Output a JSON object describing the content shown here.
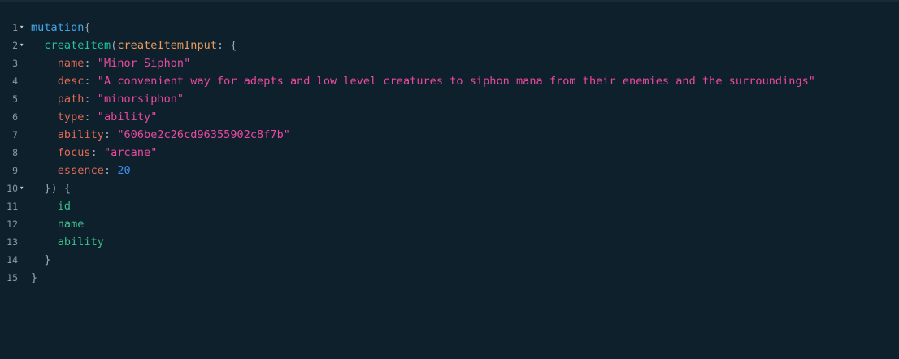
{
  "lines": [
    {
      "n": "1",
      "fold": "▾",
      "parts": [
        {
          "t": "mutation",
          "c": "kw"
        },
        {
          "t": "{",
          "c": "pun"
        }
      ]
    },
    {
      "n": "2",
      "fold": "▾",
      "parts": [
        {
          "t": "  ",
          "c": ""
        },
        {
          "t": "createItem",
          "c": "fn"
        },
        {
          "t": "(",
          "c": "pun"
        },
        {
          "t": "createItemInput",
          "c": "arg"
        },
        {
          "t": ": {",
          "c": "pun"
        }
      ]
    },
    {
      "n": "3",
      "fold": "",
      "parts": [
        {
          "t": "    ",
          "c": ""
        },
        {
          "t": "name",
          "c": "key"
        },
        {
          "t": ": ",
          "c": "pun"
        },
        {
          "t": "\"Minor Siphon\"",
          "c": "str"
        }
      ]
    },
    {
      "n": "4",
      "fold": "",
      "parts": [
        {
          "t": "    ",
          "c": ""
        },
        {
          "t": "desc",
          "c": "key"
        },
        {
          "t": ": ",
          "c": "pun"
        },
        {
          "t": "\"A convenient way for adepts and low level creatures to siphon mana from their enemies and the surroundings\"",
          "c": "str"
        }
      ]
    },
    {
      "n": "5",
      "fold": "",
      "parts": [
        {
          "t": "    ",
          "c": ""
        },
        {
          "t": "path",
          "c": "key"
        },
        {
          "t": ": ",
          "c": "pun"
        },
        {
          "t": "\"minorsiphon\"",
          "c": "str"
        }
      ]
    },
    {
      "n": "6",
      "fold": "",
      "parts": [
        {
          "t": "    ",
          "c": ""
        },
        {
          "t": "type",
          "c": "key"
        },
        {
          "t": ": ",
          "c": "pun"
        },
        {
          "t": "\"ability\"",
          "c": "str"
        }
      ]
    },
    {
      "n": "7",
      "fold": "",
      "parts": [
        {
          "t": "    ",
          "c": ""
        },
        {
          "t": "ability",
          "c": "key"
        },
        {
          "t": ": ",
          "c": "pun"
        },
        {
          "t": "\"606be2c26cd96355902c8f7b\"",
          "c": "str"
        }
      ]
    },
    {
      "n": "8",
      "fold": "",
      "parts": [
        {
          "t": "    ",
          "c": ""
        },
        {
          "t": "focus",
          "c": "key"
        },
        {
          "t": ": ",
          "c": "pun"
        },
        {
          "t": "\"arcane\"",
          "c": "str"
        }
      ]
    },
    {
      "n": "9",
      "fold": "",
      "cursor": true,
      "parts": [
        {
          "t": "    ",
          "c": ""
        },
        {
          "t": "essence",
          "c": "key"
        },
        {
          "t": ": ",
          "c": "pun"
        },
        {
          "t": "20",
          "c": "num"
        }
      ]
    },
    {
      "n": "10",
      "fold": "▾",
      "parts": [
        {
          "t": "  ",
          "c": ""
        },
        {
          "t": "}) {",
          "c": "pun"
        }
      ]
    },
    {
      "n": "11",
      "fold": "",
      "parts": [
        {
          "t": "    ",
          "c": ""
        },
        {
          "t": "id",
          "c": "fld"
        }
      ]
    },
    {
      "n": "12",
      "fold": "",
      "parts": [
        {
          "t": "    ",
          "c": ""
        },
        {
          "t": "name",
          "c": "fld"
        }
      ]
    },
    {
      "n": "13",
      "fold": "",
      "parts": [
        {
          "t": "    ",
          "c": ""
        },
        {
          "t": "ability",
          "c": "fld"
        }
      ]
    },
    {
      "n": "14",
      "fold": "",
      "parts": [
        {
          "t": "  ",
          "c": ""
        },
        {
          "t": "}",
          "c": "pun"
        }
      ]
    },
    {
      "n": "15",
      "fold": "",
      "parts": [
        {
          "t": "}",
          "c": "pun"
        }
      ]
    }
  ],
  "colors": {
    "background": "#0f202d",
    "keyword": "#3fa9e8",
    "field": "#23c29a",
    "argument": "#e99c5e",
    "key": "#e06a53",
    "string": "#ea4aa0",
    "number": "#3c8fe8"
  },
  "icons": {
    "fold": "chevron-down-icon"
  }
}
